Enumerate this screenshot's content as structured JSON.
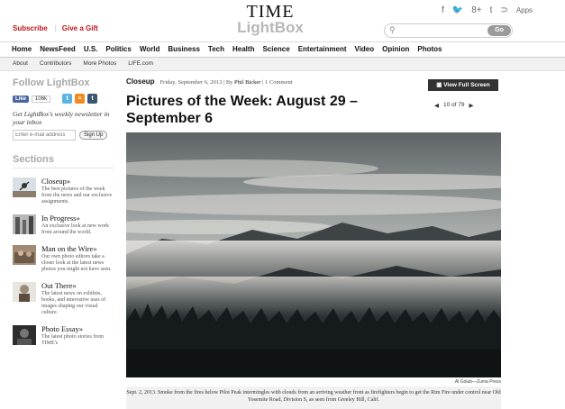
{
  "header": {
    "subscribe": "Subscribe",
    "gift": "Give a Gift",
    "logo_time": "TIME",
    "logo_lightbox": "LightBox",
    "social": {
      "facebook": "f",
      "twitter": "🐦",
      "gplus": "8+",
      "tumblr": "t",
      "rss": "⊃",
      "apps": "Apps"
    },
    "search_placeholder": "",
    "search_go": "Go"
  },
  "nav": [
    "Home",
    "NewsFeed",
    "U.S.",
    "Politics",
    "World",
    "Business",
    "Tech",
    "Health",
    "Science",
    "Entertainment",
    "Video",
    "Opinion",
    "Photos"
  ],
  "subnav": [
    "About",
    "Contributors",
    "More Photos",
    "LIFE.com"
  ],
  "sidebar": {
    "follow": "Follow LightBox",
    "like_label": "Like",
    "like_count": "106k",
    "newsletter": "Get LightBox's weekly newsletter in your inbox",
    "email_placeholder": "Enter e-mail address",
    "signup": "Sign Up",
    "sections_title": "Sections",
    "sections": [
      {
        "title": "Closeup»",
        "desc": "The best pictures of the week from the news and our exclusive assignments."
      },
      {
        "title": "In Progress»",
        "desc": "An exclusive look at new work from around the world."
      },
      {
        "title": "Man on the Wire»",
        "desc": "Our own photo editors take a closer look at the latest news photos you might not have seen."
      },
      {
        "title": "Out There»",
        "desc": "The latest news on exhibits, books, and innovative uses of images shaping our visual culture."
      },
      {
        "title": "Photo Essay»",
        "desc": "The latest photo stories from TIME's"
      }
    ]
  },
  "article": {
    "category": "Closeup",
    "date": "Friday, September 6, 2013 | By",
    "author": "Phil Bicker",
    "comments": "| 1 Comment",
    "title": "Pictures of the Week: August 29 – September 6",
    "view_full": "View Full Screen",
    "pager": "10 of 79",
    "credit": "Al Golub—Zuma Press",
    "caption": "Sept. 2, 2013. Smoke from the fires below Pilot Peak intermingles with clouds from an arriving weather front as firefighters begin to get the Rim Fire under control near Old Yosemite Road, Division S, as seen from Greeley Hill, Calif."
  }
}
